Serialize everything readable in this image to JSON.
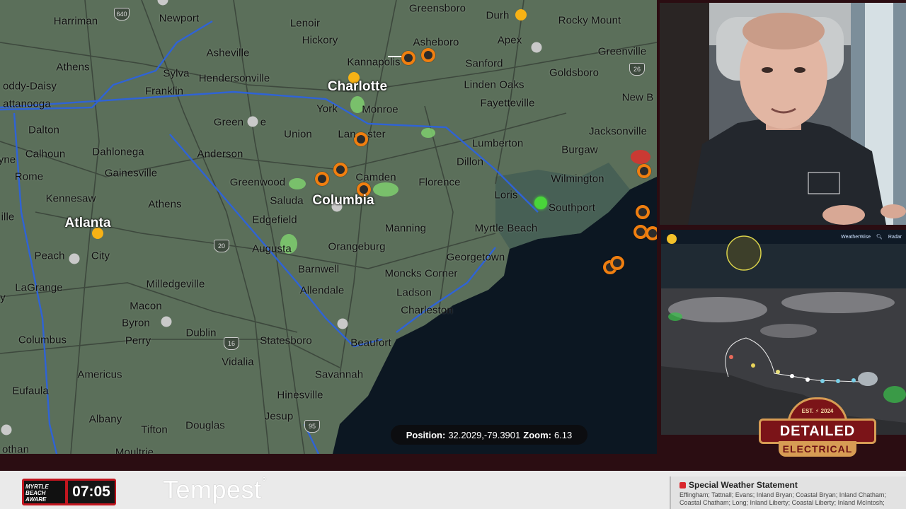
{
  "cities": [
    {
      "name": "Harriman",
      "style": "normal"
    },
    {
      "name": "Newport",
      "style": "normal"
    },
    {
      "name": "Lenoir",
      "style": "normal"
    },
    {
      "name": "Greensboro",
      "style": "normal"
    },
    {
      "name": "Durh",
      "style": "normal"
    },
    {
      "name": "Rocky Mount",
      "style": "normal"
    },
    {
      "name": "Asheboro",
      "style": "normal"
    },
    {
      "name": "Hickory",
      "style": "normal"
    },
    {
      "name": "Apex",
      "style": "normal"
    },
    {
      "name": "Asheville",
      "style": "normal"
    },
    {
      "name": "Greenville",
      "style": "normal"
    },
    {
      "name": "Kannapolis",
      "style": "normal"
    },
    {
      "name": "Sanford",
      "style": "normal"
    },
    {
      "name": "Athens",
      "style": "normal"
    },
    {
      "name": "Sylva",
      "style": "normal"
    },
    {
      "name": "Goldsboro",
      "style": "normal"
    },
    {
      "name": "Hendersonville",
      "style": "normal"
    },
    {
      "name": "oddy-Daisy",
      "style": "normal"
    },
    {
      "name": "Linden Oaks",
      "style": "normal"
    },
    {
      "name": "Franklin",
      "style": "normal"
    },
    {
      "name": "Charlotte",
      "style": "big-white"
    },
    {
      "name": "New B",
      "style": "normal"
    },
    {
      "name": "attanooga",
      "style": "normal"
    },
    {
      "name": "Fayetteville",
      "style": "normal"
    },
    {
      "name": "York",
      "style": "normal"
    },
    {
      "name": "Monroe",
      "style": "normal"
    },
    {
      "name": "Green",
      "style": "normal"
    },
    {
      "name": "e",
      "style": "normal"
    },
    {
      "name": "Dalton",
      "style": "normal"
    },
    {
      "name": "Union",
      "style": "normal"
    },
    {
      "name": "Jacksonville",
      "style": "normal"
    },
    {
      "name": "Lan",
      "style": "normal"
    },
    {
      "name": "ster",
      "style": "normal"
    },
    {
      "name": "Lumberton",
      "style": "normal"
    },
    {
      "name": "Calhoun",
      "style": "normal"
    },
    {
      "name": "Dahlonega",
      "style": "normal"
    },
    {
      "name": "Anderson",
      "style": "normal"
    },
    {
      "name": "Burgaw",
      "style": "normal"
    },
    {
      "name": "yne",
      "style": "normal"
    },
    {
      "name": "Dillon",
      "style": "normal"
    },
    {
      "name": "Gainesville",
      "style": "normal"
    },
    {
      "name": "Rome",
      "style": "normal"
    },
    {
      "name": "Camden",
      "style": "normal"
    },
    {
      "name": "Wilmington",
      "style": "normal"
    },
    {
      "name": "Greenwood",
      "style": "normal"
    },
    {
      "name": "Florence",
      "style": "normal"
    },
    {
      "name": "Loris",
      "style": "normal"
    },
    {
      "name": "Kennesaw",
      "style": "normal"
    },
    {
      "name": "Saluda",
      "style": "normal"
    },
    {
      "name": "Columbia",
      "style": "big-white"
    },
    {
      "name": "Athens",
      "style": "normal"
    },
    {
      "name": "Southport",
      "style": "normal"
    },
    {
      "name": "ille",
      "style": "normal"
    },
    {
      "name": "Edgefield",
      "style": "normal"
    },
    {
      "name": "Atlanta",
      "style": "big-white"
    },
    {
      "name": "Manning",
      "style": "normal"
    },
    {
      "name": "Myrtle Beach",
      "style": "normal"
    },
    {
      "name": "Augusta",
      "style": "normal"
    },
    {
      "name": "Orangeburg",
      "style": "normal"
    },
    {
      "name": "Peach",
      "style": "normal"
    },
    {
      "name": "City",
      "style": "normal"
    },
    {
      "name": "Georgetown",
      "style": "normal"
    },
    {
      "name": "Barnwell",
      "style": "normal"
    },
    {
      "name": "Moncks Corner",
      "style": "normal"
    },
    {
      "name": "Milledgeville",
      "style": "normal"
    },
    {
      "name": "LaGrange",
      "style": "normal"
    },
    {
      "name": "Allendale",
      "style": "normal"
    },
    {
      "name": "Ladson",
      "style": "normal"
    },
    {
      "name": "y",
      "style": "normal"
    },
    {
      "name": "Macon",
      "style": "normal"
    },
    {
      "name": "Charleston",
      "style": "normal"
    },
    {
      "name": "Byron",
      "style": "normal"
    },
    {
      "name": "Dublin",
      "style": "normal"
    },
    {
      "name": "Columbus",
      "style": "normal"
    },
    {
      "name": "Perry",
      "style": "normal"
    },
    {
      "name": "Statesboro",
      "style": "normal"
    },
    {
      "name": "Beaufort",
      "style": "normal"
    },
    {
      "name": "Vidalia",
      "style": "normal"
    },
    {
      "name": "Americus",
      "style": "normal"
    },
    {
      "name": "Savannah",
      "style": "normal"
    },
    {
      "name": "Eufaula",
      "style": "normal"
    },
    {
      "name": "Hinesville",
      "style": "normal"
    },
    {
      "name": "Jesup",
      "style": "normal"
    },
    {
      "name": "Albany",
      "style": "normal"
    },
    {
      "name": "Douglas",
      "style": "normal"
    },
    {
      "name": "Tifton",
      "style": "normal"
    },
    {
      "name": "othan",
      "style": "normal"
    },
    {
      "name": "Moultrie",
      "style": "normal"
    }
  ],
  "shields": [
    "640",
    "26",
    "20",
    "16",
    "95",
    "40"
  ],
  "markers": {
    "orange": 12,
    "yellow": 3,
    "gray": 8,
    "green": 1
  },
  "map_colors": {
    "land": "#5b6f5a",
    "water": "#0c1722",
    "state_line": "#2f63d6",
    "roads": "#3a443a"
  },
  "position_readout": {
    "position_label": "Position:",
    "position_value": "32.2029,-79.3901",
    "zoom_label": "Zoom:",
    "zoom_value": "6.13"
  },
  "satellite_panel": {
    "brand": "WeatherWise",
    "search_icon": "search-icon",
    "radar_label": "Radar"
  },
  "logo": {
    "est": "EST. ⚡ 2024",
    "line1": "DETAILED",
    "line2": "ELECTRICAL"
  },
  "bottom_bar": {
    "brand_line1": "MYRTLE BEACH",
    "brand_line2": "AWARE",
    "clock": "07:05",
    "tempest": "Tempest",
    "alert_title": "Special Weather Statement",
    "alert_body": "Effingham; Tattnall; Evans; Inland Bryan; Coastal Bryan; Inland Chatham; Coastal Chatham; Long; Inland Liberty; Coastal Liberty; Inland McIntosh;"
  }
}
